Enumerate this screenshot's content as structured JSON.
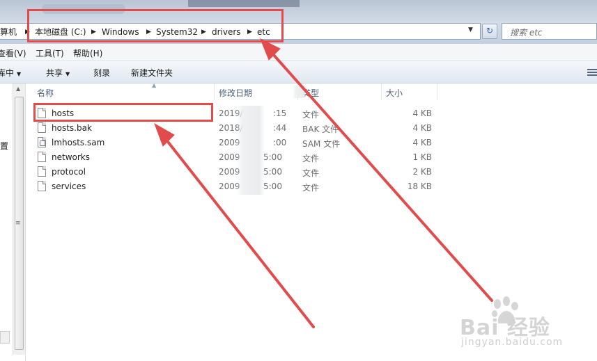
{
  "address": {
    "crumbs": [
      "算机",
      "本地磁盘 (C:)",
      "Windows",
      "System32",
      "drivers",
      "etc"
    ],
    "search_placeholder": "搜索 etc"
  },
  "menu": [
    "查看(V)",
    "工具(T)",
    "帮助(H)"
  ],
  "toolbar": [
    "库中",
    "共享",
    "刻录",
    "新建文件夹"
  ],
  "nav": {
    "partial_label": "置"
  },
  "columns": [
    "名称",
    "修改日期",
    "类型",
    "大小"
  ],
  "files": [
    {
      "name": "hosts",
      "date_start": "2019/",
      "date_end": ":15",
      "type": "文件",
      "size": "4 KB"
    },
    {
      "name": "hosts.bak",
      "date_start": "2018/",
      "date_end": ":44",
      "type": "BAK 文件",
      "size": "4 KB"
    },
    {
      "name": "lmhosts.sam",
      "date_start": "2009",
      "date_end": ":00",
      "type": "SAM 文件",
      "size": "4 KB"
    },
    {
      "name": "networks",
      "date_start": "2009",
      "date_end": "5:00",
      "type": "文件",
      "size": "1 KB"
    },
    {
      "name": "protocol",
      "date_start": "2009",
      "date_end": "5:00",
      "type": "文件",
      "size": "2 KB"
    },
    {
      "name": "services",
      "date_start": "2009",
      "date_end": "5:00",
      "type": "文件",
      "size": "18 KB"
    }
  ],
  "annotation_color": "#e24b4b",
  "watermark": {
    "brand": "Bai 经验",
    "url": "jingyan.baidu.com"
  },
  "icons": [
    "refresh-icon",
    "file-icon",
    "view-options-icon",
    "dropdown-arrow-icon"
  ]
}
